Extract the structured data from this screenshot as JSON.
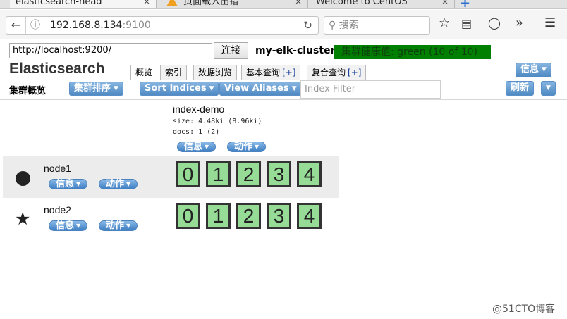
{
  "browser": {
    "tabs": [
      {
        "title": "elasticsearch-head",
        "close": "×"
      },
      {
        "title": "页面载入出错",
        "close": "×"
      },
      {
        "title": "Welcome to CentOS",
        "close": "×"
      }
    ],
    "new_tab": "+",
    "url_host": "192.168.8.134",
    "url_port": ":9100",
    "search_placeholder": "搜索"
  },
  "header": {
    "connection_url": "http://localhost:9200/",
    "connect_label": "连接",
    "cluster_name": "my-elk-cluster",
    "health": "集群健康值: green (10 of 10)",
    "health_color": "#008000",
    "app_title": "Elasticsearch",
    "info_label": "信息"
  },
  "tabs": [
    {
      "label": "概览",
      "plus": ""
    },
    {
      "label": "索引",
      "plus": ""
    },
    {
      "label": "数据浏览",
      "plus": ""
    },
    {
      "label": "基本查询",
      "plus": "[+]"
    },
    {
      "label": "复合查询",
      "plus": "[+]"
    }
  ],
  "toolbar": {
    "overview_label": "集群概览",
    "sort_cluster": "集群排序",
    "sort_indices": "Sort Indices",
    "view_aliases": "View Aliases",
    "filter_placeholder": "Index Filter",
    "refresh": "刷新"
  },
  "index": {
    "name": "index-demo",
    "size": "size: 4.48ki (8.96ki)",
    "docs": "docs: 1 (2)",
    "info": "信息",
    "action": "动作"
  },
  "nodes": [
    {
      "name": "node1",
      "info": "信息",
      "action": "动作",
      "shards": [
        "0",
        "1",
        "2",
        "3",
        "4"
      ]
    },
    {
      "name": "node2",
      "info": "信息",
      "action": "动作",
      "shards": [
        "0",
        "1",
        "2",
        "3",
        "4"
      ]
    }
  ],
  "shard_color": "#96db96",
  "watermark": "@51CTO博客"
}
